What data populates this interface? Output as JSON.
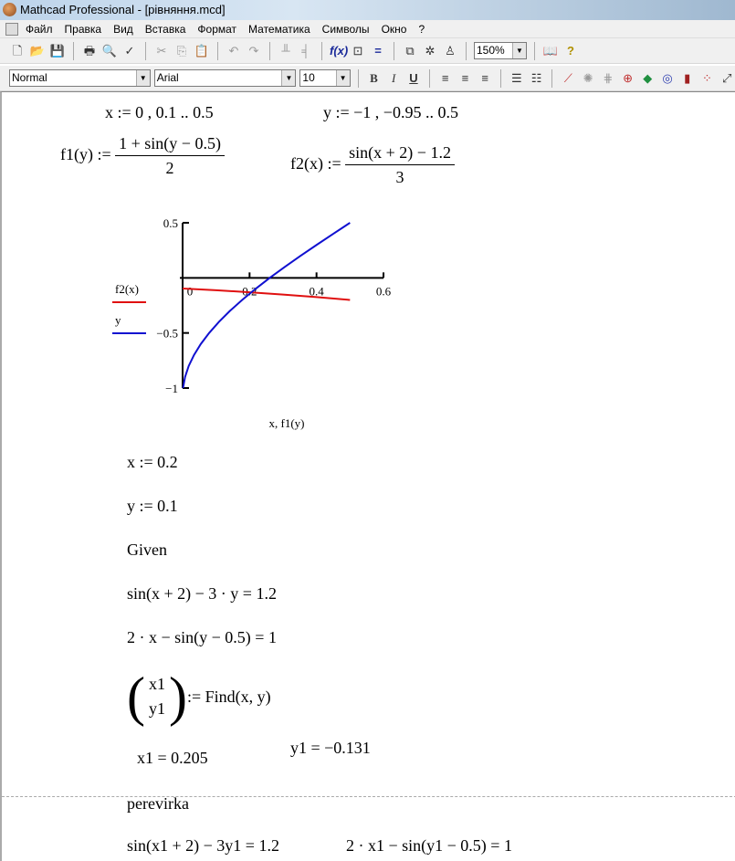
{
  "window": {
    "title": "Mathcad Professional - [рівняння.mcd]"
  },
  "menu": [
    "Файл",
    "Правка",
    "Вид",
    "Вставка",
    "Формат",
    "Математика",
    "Символы",
    "Окно",
    "?"
  ],
  "toolbar": {
    "zoom": "150%",
    "style": "Normal",
    "font": "Arial",
    "size": "10",
    "bold": "B",
    "italic": "I",
    "underline": "U"
  },
  "doc": {
    "def_x": "x := 0 , 0.1 .. 0.5",
    "def_y": "y := −1 , −0.95 .. 0.5",
    "f1_lhs": "f1(y) :=",
    "f1_num": "1 + sin(y − 0.5)",
    "f1_den": "2",
    "f2_lhs": "f2(x) :=",
    "f2_num": "sin(x + 2) − 1.2",
    "f2_den": "3",
    "guess_x": "x := 0.2",
    "guess_y": "y := 0.1",
    "given": "Given",
    "eq1": "sin(x + 2) − 3 · y = 1.2",
    "eq2": "2 · x − sin(y − 0.5) = 1",
    "vec1": "x1",
    "vec2": "y1",
    "find": ":= Find(x, y)",
    "res_x1": "x1 = 0.205",
    "res_y1": "y1 = −0.131",
    "check_label": "perevirka",
    "check1": "sin(x1 + 2) − 3y1 = 1.2",
    "check2": "2 · x1 − sin(y1 − 0.5) = 1"
  },
  "chart_data": {
    "type": "line",
    "xlabel": "x, f1(y)",
    "xlim": [
      0,
      0.6
    ],
    "ylim": [
      -1,
      0.5
    ],
    "xticks": [
      "0",
      "0.2",
      "0.4",
      "0.6"
    ],
    "yticks": [
      "0.5",
      "−0.5",
      "−1"
    ],
    "series": [
      {
        "name": "f2(x)",
        "color": "#e01010",
        "x": [
          0,
          0.1,
          0.2,
          0.3,
          0.4,
          0.5
        ],
        "y": [
          -0.0969,
          -0.1123,
          -0.1305,
          -0.1514,
          -0.1748,
          -0.2005
        ]
      },
      {
        "name": "y",
        "color": "#1010d0",
        "x": [
          0.0013,
          0.0073,
          0.0182,
          0.034,
          0.0544,
          0.0793,
          0.1084,
          0.1413,
          0.1779,
          0.2177,
          0.2603,
          0.3053,
          0.3522,
          0.4007,
          0.4501,
          0.5
        ],
        "y": [
          -1,
          -0.9,
          -0.8,
          -0.7,
          -0.6,
          -0.5,
          -0.4,
          -0.3,
          -0.2,
          -0.1,
          0,
          0.1,
          0.2,
          0.3,
          0.4,
          0.5
        ]
      }
    ]
  }
}
